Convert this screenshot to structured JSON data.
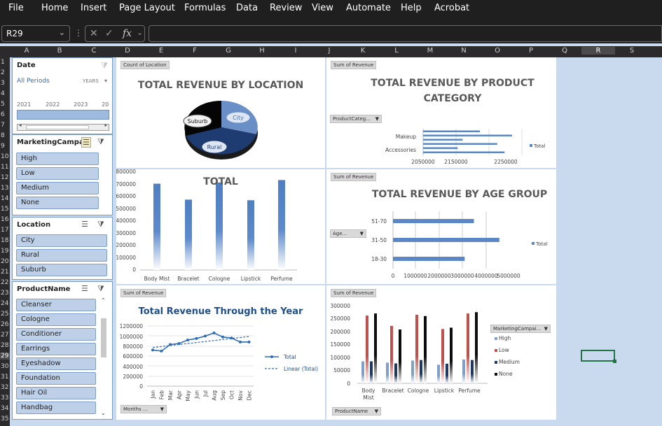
{
  "menu": [
    "File",
    "Home",
    "Insert",
    "Page Layout",
    "Formulas",
    "Data",
    "Review",
    "View",
    "Automate",
    "Help",
    "Acrobat"
  ],
  "namebox": "R29",
  "columns": [
    "A",
    "B",
    "C",
    "D",
    "E",
    "F",
    "G",
    "H",
    "I",
    "J",
    "K",
    "L",
    "M",
    "N",
    "O",
    "P",
    "Q",
    "R",
    "S"
  ],
  "rows": [
    "1",
    "2",
    "3",
    "4",
    "5",
    "6",
    "7",
    "8",
    "9",
    "10",
    "11",
    "12",
    "13",
    "14",
    "15",
    "16",
    "17",
    "18",
    "19",
    "20",
    "21",
    "22",
    "23",
    "24",
    "25",
    "26",
    "27",
    "28",
    "29",
    "30",
    "31",
    "32",
    "33",
    "34",
    "35"
  ],
  "timeline": {
    "label": "Date",
    "period": "All Periods",
    "unit": "YEARS",
    "years": [
      "2021",
      "2022",
      "2023",
      "20"
    ]
  },
  "slicers": {
    "campaign": {
      "label": "MarketingCampa...",
      "items": [
        "High",
        "Low",
        "Medium",
        "None"
      ]
    },
    "location": {
      "label": "Location",
      "items": [
        "City",
        "Rural",
        "Suburb"
      ]
    },
    "product": {
      "label": "ProductName",
      "items": [
        "Cleanser",
        "Cologne",
        "Conditioner",
        "Earrings",
        "Eyeshadow",
        "Foundation",
        "Hair Oil",
        "Handbag"
      ]
    }
  },
  "charts": {
    "location": {
      "tag": "Count of Location",
      "title": "TOTAL REVENUE BY LOCATION",
      "labels": [
        "City",
        "Rural",
        "Suburb"
      ]
    },
    "category": {
      "tag": "Sum of Revenue",
      "title_lines": [
        "TOTAL REVENUE BY PRODUCT",
        "CATEGORY"
      ],
      "filter": "ProductCateg...",
      "y_labels": [
        "Makeup",
        "Accessories"
      ],
      "x_ticks": [
        "2050000",
        "2150000",
        "2250000"
      ],
      "legend": "Total"
    },
    "product_total": {
      "title": "TOTAL",
      "y_ticks": [
        "800000",
        "700000",
        "600000",
        "500000",
        "400000",
        "300000",
        "200000",
        "100000",
        "0"
      ]
    },
    "age": {
      "tag": "Sum of Revenue",
      "title": "TOTAL REVENUE BY AGE GROUP",
      "filter": "Age...",
      "x_ticks": [
        "0",
        "1000000",
        "2000000",
        "3000000",
        "4000000",
        "5000000"
      ],
      "legend": "Total"
    },
    "year": {
      "tag": "Sum of Revenue",
      "title": "Total Revenue Through the Year",
      "filter": "Months ...",
      "y_ticks": [
        "1200000",
        "1000000",
        "800000",
        "600000",
        "400000",
        "200000",
        "0"
      ],
      "legend_total": "Total",
      "legend_linear": "Linear (Total)"
    },
    "campaign": {
      "tag": "Sum of Revenue",
      "filter": "ProductName",
      "legend_title": "MarketingCampai...",
      "y_ticks": [
        "300000",
        "250000",
        "200000",
        "150000",
        "100000",
        "50000",
        "0"
      ]
    }
  },
  "chart_data": [
    {
      "type": "pie",
      "title": "TOTAL REVENUE BY LOCATION",
      "categories": [
        "City",
        "Rural",
        "Suburb"
      ],
      "values": [
        34,
        33,
        33
      ]
    },
    {
      "type": "bar",
      "title": "TOTAL REVENUE BY PRODUCT CATEGORY",
      "categories": [
        "Accessories",
        "",
        "",
        "",
        "Makeup",
        ""
      ],
      "values": [
        2215000,
        2120000,
        2200000,
        2130000,
        2230000,
        2165000
      ],
      "xlim": [
        2050000,
        2250000
      ]
    },
    {
      "type": "bar",
      "title": "TOTAL",
      "categories": [
        "Body Mist",
        "Bracelet",
        "Cologne",
        "Lipstick",
        "Perfume"
      ],
      "values": [
        705000,
        575000,
        715000,
        570000,
        735000
      ],
      "ylim": [
        0,
        800000
      ]
    },
    {
      "type": "bar",
      "title": "TOTAL REVENUE BY AGE GROUP",
      "categories": [
        "18-30",
        "31-50",
        "51-70"
      ],
      "values": [
        3100000,
        4600000,
        3500000
      ],
      "xlim": [
        0,
        5000000
      ]
    },
    {
      "type": "line",
      "title": "Total Revenue Through the Year",
      "categories": [
        "Jan",
        "Feb",
        "Mar",
        "Apr",
        "May",
        "Jun",
        "Jul",
        "Aug",
        "Sep",
        "Oct",
        "Nov",
        "Dec"
      ],
      "series": [
        {
          "name": "Total",
          "values": [
            720000,
            700000,
            830000,
            850000,
            920000,
            950000,
            1000000,
            1060000,
            980000,
            960000,
            880000,
            880000
          ]
        },
        {
          "name": "Linear (Total)",
          "values": [
            770000,
            790000,
            810000,
            830000,
            850000,
            870000,
            890000,
            910000,
            930000,
            950000,
            970000,
            990000
          ]
        }
      ],
      "ylim": [
        0,
        1200000
      ]
    },
    {
      "type": "bar",
      "categories": [
        "Body Mist",
        "Bracelet",
        "Cologne",
        "Lipstick",
        "Perfume"
      ],
      "series": [
        {
          "name": "High",
          "values": [
            85000,
            80000,
            88000,
            72000,
            92000
          ]
        },
        {
          "name": "Low",
          "values": [
            262000,
            222000,
            265000,
            210000,
            270000
          ]
        },
        {
          "name": "Medium",
          "values": [
            85000,
            77000,
            90000,
            76000,
            90000
          ]
        },
        {
          "name": "None",
          "values": [
            270000,
            208000,
            260000,
            215000,
            275000
          ]
        }
      ],
      "ylim": [
        0,
        300000
      ]
    }
  ]
}
